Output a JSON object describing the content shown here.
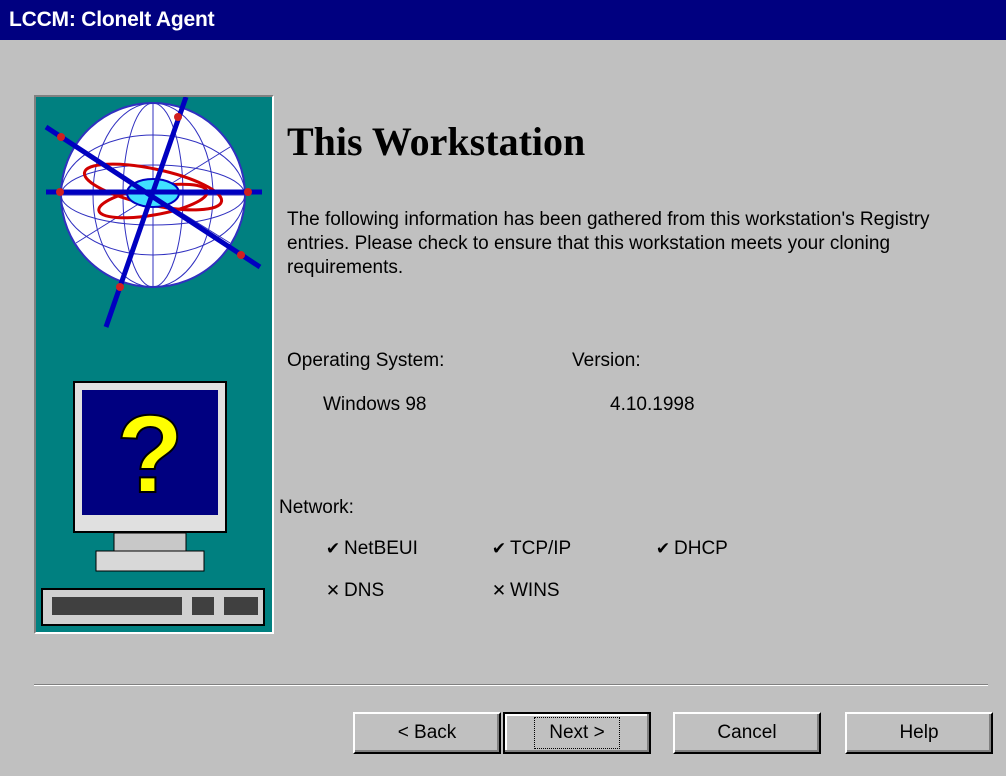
{
  "window": {
    "title": "LCCM: CloneIt Agent"
  },
  "page": {
    "heading": "This Workstation",
    "description": "The following information has been gathered from this workstation's Registry entries.  Please check to ensure that this workstation meets your cloning requirements."
  },
  "system": {
    "os_label": "Operating System:",
    "os_value": "Windows 98",
    "version_label": "Version:",
    "version_value": "4.10.1998"
  },
  "network": {
    "label": "Network:",
    "items": [
      {
        "name": "NetBEUI",
        "status": "checked",
        "mark": "✔"
      },
      {
        "name": "TCP/IP",
        "status": "checked",
        "mark": "✔"
      },
      {
        "name": "DHCP",
        "status": "checked",
        "mark": "✔"
      },
      {
        "name": "DNS",
        "status": "unchecked",
        "mark": "✕"
      },
      {
        "name": "WINS",
        "status": "unchecked",
        "mark": "✕"
      }
    ]
  },
  "buttons": {
    "back": "< Back",
    "next": "Next >",
    "cancel": "Cancel",
    "help": "Help"
  },
  "colors": {
    "titlebar": "#000080",
    "face": "#c0c0c0",
    "art_background": "#008080",
    "question_mark": "#ffff00"
  }
}
